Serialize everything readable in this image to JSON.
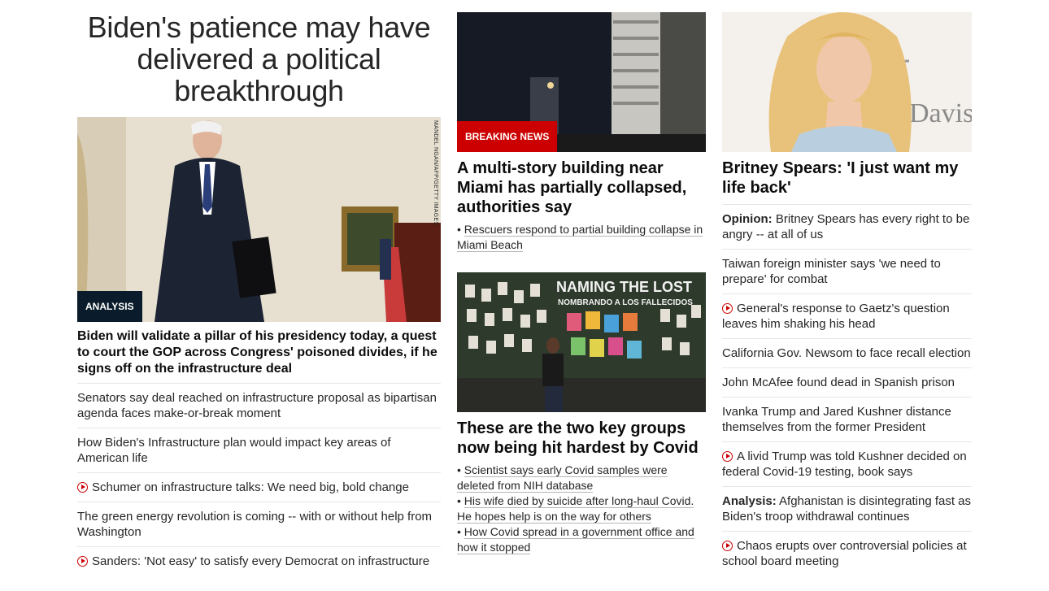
{
  "left": {
    "title": "Biden's patience may have delivered a political breakthrough",
    "image_credit": "MANDEL NGAN/AFP/GETTY IMAGES",
    "image_label": "ANALYSIS",
    "headline": "Biden will validate a pillar of his presidency today, a quest to court the GOP across Congress' poisoned divides, if he signs off on the infrastructure deal",
    "items": [
      {
        "text": "Senators say deal reached on infrastructure proposal as bipartisan agenda faces make-or-break moment",
        "video": false
      },
      {
        "text": "How Biden's Infrastructure plan would impact key areas of American life",
        "video": false
      },
      {
        "text": "Schumer on infrastructure talks: We need big, bold change",
        "video": true
      },
      {
        "text": "The green energy revolution is coming -- with or without help from Washington",
        "video": false
      },
      {
        "text": "Sanders: 'Not easy' to satisfy every Democrat on infrastructure",
        "video": true
      }
    ]
  },
  "middle": {
    "story1": {
      "image_label": "BREAKING NEWS",
      "title": "A multi-story building near Miami has partially collapsed, authorities say",
      "bullets": [
        "Rescuers respond to partial building collapse in Miami Beach"
      ]
    },
    "story2": {
      "image_text_main": "NAMING THE LOST",
      "image_text_sub": "NOMBRANDO A LOS FALLECIDOS",
      "title": "These are the two key groups now being hit hardest by Covid",
      "bullets": [
        "Scientist says early Covid samples were deleted from NIH database",
        "His wife died by suicide after long-haul Covid. He hopes help is on the way for others",
        "How Covid spread in a government office and how it stopped"
      ]
    }
  },
  "right": {
    "image_text": "Davis",
    "title": "Britney Spears: 'I just want my life back'",
    "items": [
      {
        "prefix": "Opinion:",
        "text": "Britney Spears has every right to be angry -- at all of us",
        "video": false
      },
      {
        "prefix": "",
        "text": "Taiwan foreign minister says 'we need to prepare' for combat",
        "video": false
      },
      {
        "prefix": "",
        "text": "General's response to Gaetz's question leaves him shaking his head",
        "video": true
      },
      {
        "prefix": "",
        "text": "California Gov. Newsom to face recall election",
        "video": false
      },
      {
        "prefix": "",
        "text": "John McAfee found dead in Spanish prison",
        "video": false
      },
      {
        "prefix": "",
        "text": "Ivanka Trump and Jared Kushner distance themselves from the former President",
        "video": false
      },
      {
        "prefix": "",
        "text": "A livid Trump was told Kushner decided on federal Covid-19 testing, book says",
        "video": true
      },
      {
        "prefix": "Analysis:",
        "text": "Afghanistan is disintegrating fast as Biden's troop withdrawal continues",
        "video": false
      },
      {
        "prefix": "",
        "text": "Chaos erupts over controversial policies at school board meeting",
        "video": true
      }
    ]
  },
  "colors": {
    "accent_red": "#cc0000",
    "analysis_bg": "#0a1c2c",
    "text": "#262626"
  }
}
